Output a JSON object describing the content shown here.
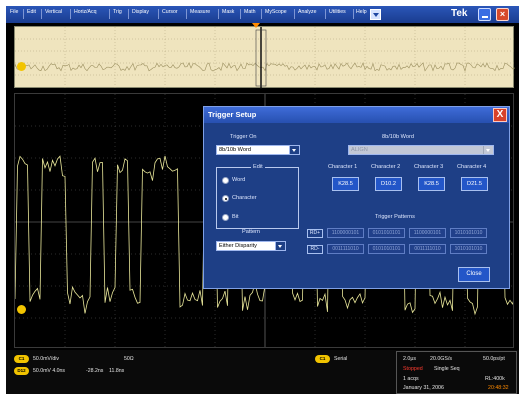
{
  "menu": {
    "items": [
      "File",
      "Edit",
      "Vertical",
      "Horiz/Acq",
      "Trig",
      "Display",
      "Cursor",
      "Measure",
      "Mask",
      "Math",
      "MyScope",
      "Analyze",
      "Utilities",
      "Help"
    ],
    "logo": "Tek"
  },
  "icons": {
    "help": "help-arrow-icon",
    "minimize": "minimize-icon",
    "close": "close-icon",
    "channel_marker": "ch1-level-marker",
    "trigger_marker": "trigger-position-marker"
  },
  "dialog": {
    "title": "Trigger Setup",
    "close_glyph": "X",
    "trigger_on_label": "Trigger On",
    "trigger_on_value": "8b/10b Word",
    "edit_label": "Edit",
    "edit_options": [
      "Word",
      "Character",
      "Bit"
    ],
    "edit_selected": "Character",
    "pattern_label": "Pattern",
    "pattern_value": "Either Disparity",
    "word_label": "8b/10b Word",
    "word_value": "ALIGN",
    "characters": [
      {
        "label": "Character 1",
        "value": "K28.5"
      },
      {
        "label": "Character 2",
        "value": "D10.2"
      },
      {
        "label": "Character 3",
        "value": "K28.5"
      },
      {
        "label": "Character 4",
        "value": "D21.5"
      }
    ],
    "patterns_label": "Trigger Patterns",
    "rd_plus": "RD+",
    "rd_minus": "RD-",
    "rd_plus_patterns": [
      "1100000101",
      "0101010101",
      "1100000101",
      "1010101010"
    ],
    "rd_minus_patterns": [
      "0011111010",
      "0101010101",
      "0011111010",
      "1010101010"
    ],
    "close_button": "Close"
  },
  "status": {
    "ch1_badge": "C1",
    "ch1_text": "50.0mV/div",
    "ch1_impedance": "50Ω",
    "ref_badge": "D12",
    "ref_text": "50.0mV  4.0ns",
    "ref_time1": "-28.2ns",
    "ref_time2": "11.8ns",
    "bus_badge": "C1",
    "bus_text": "Serial",
    "timebase": "2.0μs",
    "sample_rate": "20.0GS/s",
    "resolution": "50.0ps/pt",
    "run_state": "Stopped",
    "seq_mode": "Single Seq",
    "acqs": "1 acqs",
    "record_length": "RL:400k",
    "date": "January 31, 2006",
    "time": "20:48:32"
  },
  "colors": {
    "menubar": "#1f47a3",
    "dialog": "#1e3f86",
    "waveform": "#e9e79a",
    "channel1": "#f2c400",
    "stopped": "#ff3b2f",
    "time": "#ff8a00"
  }
}
